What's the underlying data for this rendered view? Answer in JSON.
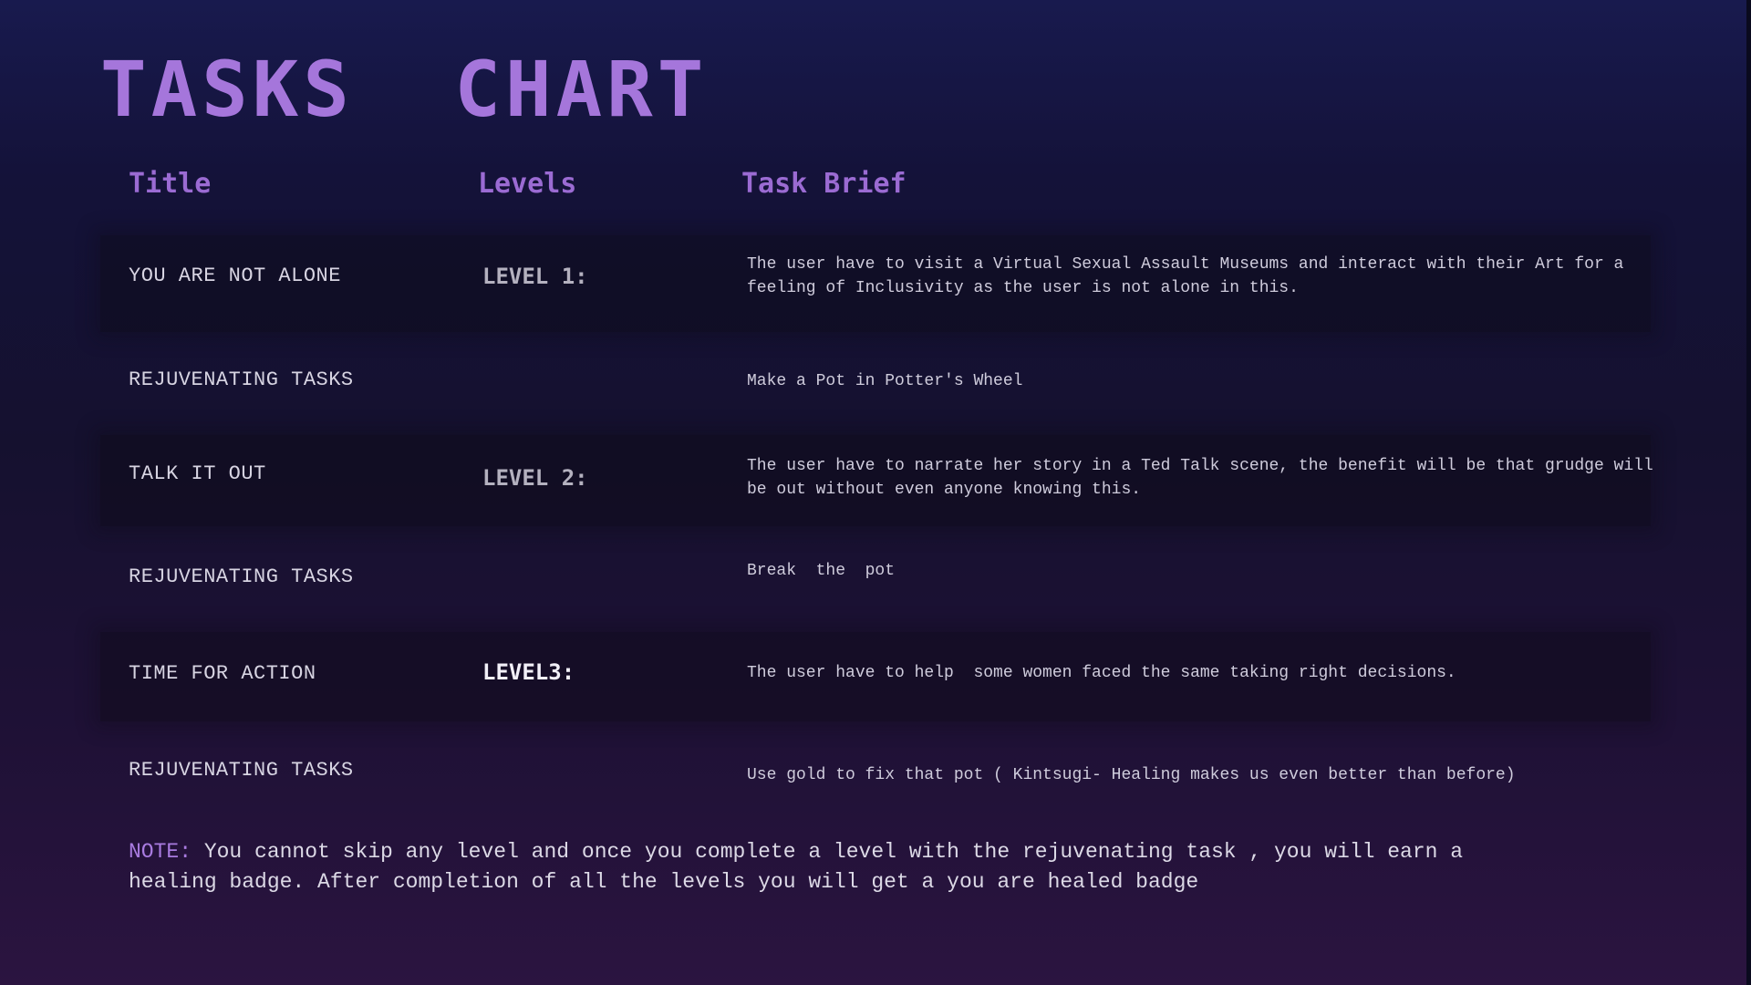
{
  "page": {
    "title": "TASKS  CHART"
  },
  "columns": {
    "title": "Title",
    "levels": "Levels",
    "brief": "Task Brief"
  },
  "rows": [
    {
      "title": "YOU ARE NOT ALONE",
      "level": "LEVEL 1:",
      "brief": "The user have to visit a Virtual Sexual Assault Museums and interact with their Art for a feeling of Inclusivity as the user is not alone in this."
    },
    {
      "title": "REJUVENATING TASKS",
      "level": "",
      "brief": "Make a Pot in Potter's Wheel"
    },
    {
      "title": "TALK IT OUT",
      "level": "LEVEL 2:",
      "brief": "The user have to narrate her story in a Ted Talk scene, the benefit will be that grudge will be out without even anyone knowing this."
    },
    {
      "title": "REJUVENATING TASKS",
      "level": "",
      "brief": "Break  the  pot"
    },
    {
      "title": "TIME FOR ACTION",
      "level": "LEVEL3:",
      "brief": "The user have to help  some women faced the same taking right decisions."
    },
    {
      "title": "REJUVENATING TASKS",
      "level": "",
      "brief": "Use gold to fix that pot ( Kintsugi- Healing makes us even better than before)"
    }
  ],
  "note": {
    "label": "NOTE:",
    "text": " You cannot skip any level and once you complete a level with the rejuvenating task , you will earn a healing badge. After completion of all the levels you will get a you are healed badge"
  },
  "colors": {
    "title": "#a576db",
    "header": "#9b6bd3",
    "note_label": "#a97be0",
    "body_text": "#d7d4e2"
  }
}
